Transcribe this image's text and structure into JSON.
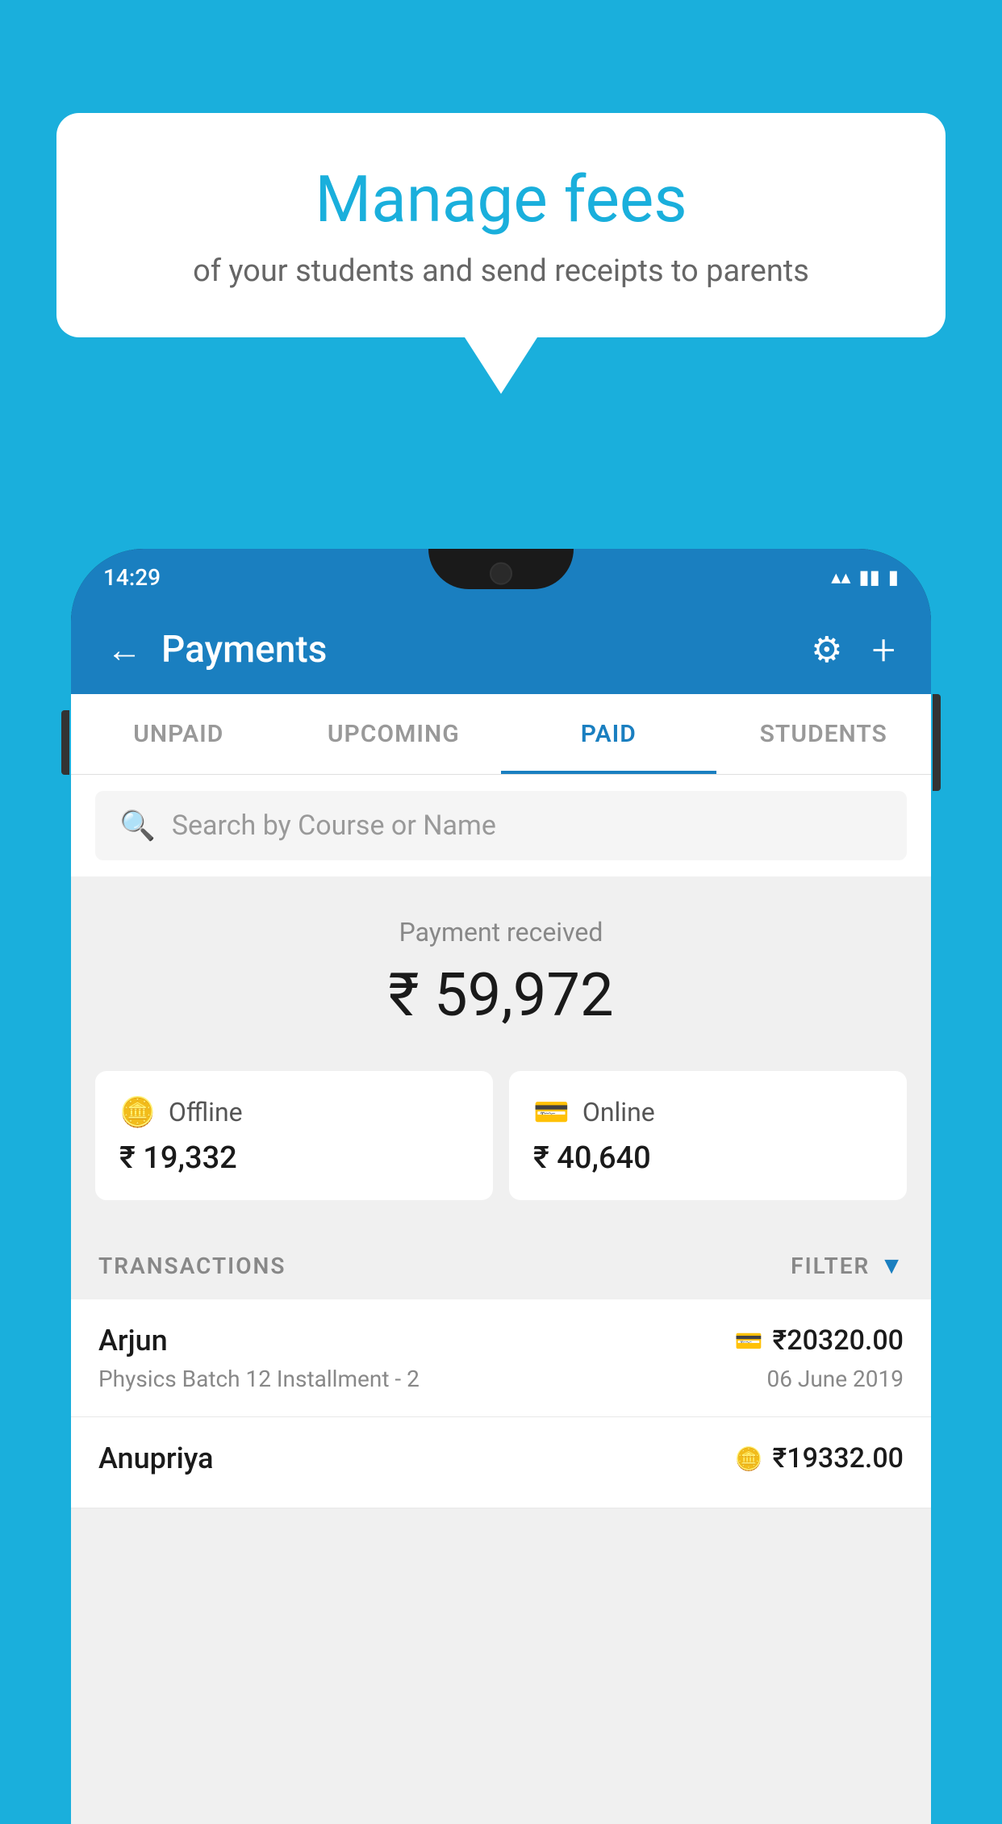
{
  "background_color": "#1AAFDC",
  "speech_bubble": {
    "title": "Manage fees",
    "subtitle": "of your students and send receipts to parents"
  },
  "status_bar": {
    "time": "14:29",
    "wifi_icon": "▲",
    "signal_icon": "◀",
    "battery_icon": "▮"
  },
  "header": {
    "title": "Payments",
    "back_icon": "←",
    "gear_icon": "⚙",
    "plus_icon": "+"
  },
  "tabs": [
    {
      "label": "UNPAID",
      "active": false
    },
    {
      "label": "UPCOMING",
      "active": false
    },
    {
      "label": "PAID",
      "active": true
    },
    {
      "label": "STUDENTS",
      "active": false
    }
  ],
  "search": {
    "placeholder": "Search by Course or Name"
  },
  "payment_summary": {
    "received_label": "Payment received",
    "amount": "₹ 59,972",
    "offline_label": "Offline",
    "offline_amount": "₹ 19,332",
    "online_label": "Online",
    "online_amount": "₹ 40,640"
  },
  "transactions": {
    "section_label": "TRANSACTIONS",
    "filter_label": "FILTER",
    "items": [
      {
        "name": "Arjun",
        "course": "Physics Batch 12 Installment - 2",
        "amount": "₹20320.00",
        "date": "06 June 2019",
        "type": "online"
      },
      {
        "name": "Anupriya",
        "course": "",
        "amount": "₹19332.00",
        "date": "",
        "type": "offline"
      }
    ]
  }
}
